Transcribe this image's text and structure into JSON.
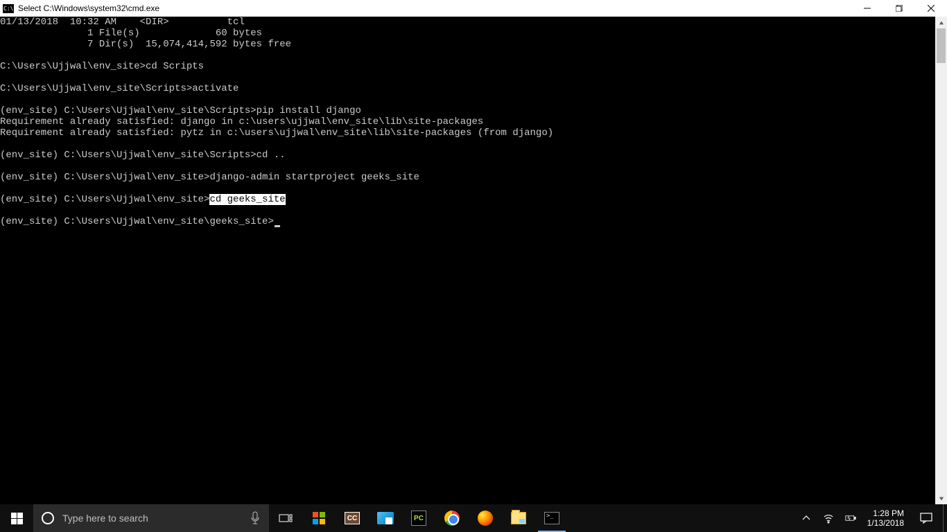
{
  "titlebar": {
    "title": "Select C:\\Windows\\system32\\cmd.exe"
  },
  "terminal": {
    "lines": [
      "01/13/2018  10:32 AM    <DIR>          tcl",
      "               1 File(s)             60 bytes",
      "               7 Dir(s)  15,074,414,592 bytes free",
      "",
      "C:\\Users\\Ujjwal\\env_site>cd Scripts",
      "",
      "C:\\Users\\Ujjwal\\env_site\\Scripts>activate",
      "",
      "(env_site) C:\\Users\\Ujjwal\\env_site\\Scripts>pip install django",
      "Requirement already satisfied: django in c:\\users\\ujjwal\\env_site\\lib\\site-packages",
      "Requirement already satisfied: pytz in c:\\users\\ujjwal\\env_site\\lib\\site-packages (from django)",
      "",
      "(env_site) C:\\Users\\Ujjwal\\env_site\\Scripts>cd ..",
      "",
      "(env_site) C:\\Users\\Ujjwal\\env_site>django-admin startproject geeks_site",
      ""
    ],
    "highlight_line_prefix": "(env_site) C:\\Users\\Ujjwal\\env_site>",
    "highlight_text": "cd geeks_site",
    "cursor_line_prompt": "(env_site) C:\\Users\\Ujjwal\\env_site\\geeks_site>"
  },
  "taskbar": {
    "search_placeholder": "Type here to search",
    "clock_time": "1:28 PM",
    "clock_date": "1/13/2018",
    "apps": {
      "store": "Microsoft Store",
      "cc": "CC",
      "dm": "Download Manager",
      "pycharm": "PC",
      "chrome": "Google Chrome",
      "firefox": "Firefox",
      "explorer": "File Explorer",
      "cmd": ">_"
    }
  }
}
